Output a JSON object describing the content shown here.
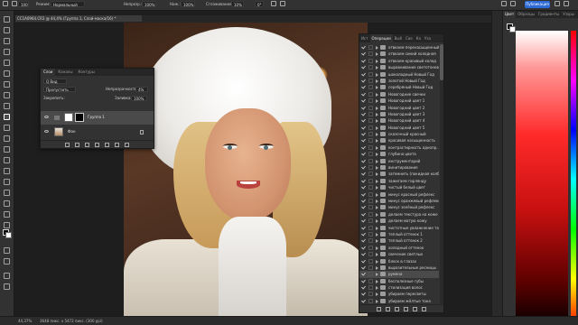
{
  "options_bar": {
    "mode_label": "Режим:",
    "mode_value": "Нормальный",
    "opacity_label": "Непрозр.:",
    "opacity_value": "100%",
    "flow_label": "Наж.:",
    "flow_value": "100%",
    "smoothing_label": "Сглаживание:",
    "smoothing_value": "10%",
    "brush_size": "100",
    "angle": "0°",
    "share_label": "Публикация"
  },
  "document": {
    "tab_title": "CC1A0964.CR3 @ 44,4% (Группа 1, Слой-маска/16) *"
  },
  "layers_panel": {
    "tabs": [
      "Слои",
      "Каналы",
      "Контуры"
    ],
    "active_tab": "Слои",
    "filter_label": "Q Вид",
    "blend_mode": "Пропустить",
    "opacity_label": "Непрозрачность:",
    "opacity_value": "4%",
    "lock_label": "Закрепить:",
    "fill_label": "Заливка:",
    "fill_value": "100%",
    "layers": [
      {
        "name": "Группа 1",
        "selected": true,
        "type": "group"
      },
      {
        "name": "Фон",
        "selected": false,
        "type": "image"
      }
    ]
  },
  "actions_panel": {
    "tabs": [
      "Ист",
      "Операции",
      "Выб",
      "Све",
      "Ка",
      "Уза"
    ],
    "active_tab": "Операции",
    "items": [
      "отвкаем перенасыщенный кв",
      "отвкаем синий холодная",
      "отвкаем красивый холод",
      "выравнивание светотонов",
      "шоколадный Новый Год",
      "золотой Новый Год",
      "серебряный Новый Год",
      "Новогодние свечки",
      "Новогодний цвет 1",
      "Новогодний цвет 2",
      "Новогодний цвет 3",
      "Новогодний цвет 4",
      "Новогодний цвет 5",
      "сказочный красный",
      "красивая насыщенность",
      "контрастирность однопр...",
      "глубина цвета",
      "инструментарий",
      "винитирование",
      "затемнить (покидная колб..",
      "зажигаем гирлянду",
      "чистый белый цвет",
      "минус красный рефлекс",
      "минус оранжевый рефлекс",
      "минус зелёный рефлекс",
      "делаем текстура на коже",
      "делаем матую кожу",
      "чистотные увлажнение тон",
      "теплый оттенок 1",
      "теплый оттенок 2",
      "холодный оттенок",
      "свечение светлых",
      "блеск в глазах",
      "выразительные ресницы",
      "румяна",
      "бесполезные губы",
      "стилизация волос",
      "убираем пересветы",
      "убираем жёлтые тона"
    ],
    "selected_index": 34
  },
  "right_panel": {
    "tabs": [
      "Цвет",
      "Образцы",
      "Градиенты",
      "Узоры"
    ],
    "active_tab": "Цвет"
  },
  "status_bar": {
    "zoom": "44,37%",
    "dimensions": "3648 пикс. x 5472 пикс. (300 ppi)"
  }
}
